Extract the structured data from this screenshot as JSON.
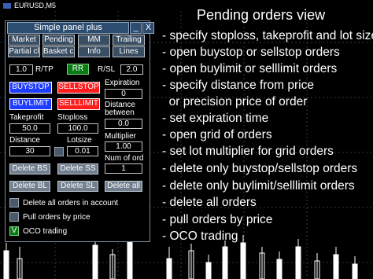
{
  "chart": {
    "symbol_title": "EURUSD,M5"
  },
  "panel": {
    "title": "Simple panel plus",
    "minimize_label": "_",
    "close_label": "X",
    "tabs_row1": [
      "Market",
      "Pending",
      "MM",
      "Trailing"
    ],
    "tabs_row2": [
      "Partial cl",
      "Basket cl",
      "Info",
      "Lines"
    ],
    "rr_ratio_value": "1.0",
    "rtp_label": "R/TP",
    "rr_button": "RR",
    "rsl_label": "R/SL",
    "rsl_value": "2.0",
    "buystop_label": "BUYSTOP",
    "sellstop_label": "SELLSTOP",
    "buylimit_label": "BUYLIMIT",
    "selllimit_label": "SELLLIMIT",
    "expiration_label": "Expiration",
    "expiration_value": "0",
    "distance_between_label_1": "Distance",
    "distance_between_label_2": "between",
    "distance_between_value": "0.0",
    "takeprofit_label": "Takeprofit",
    "takeprofit_value": "50.0",
    "stoploss_label": "Stoploss",
    "stoploss_value": "100.0",
    "multiplier_label": "Multiplier",
    "multiplier_value": "1.00",
    "distance_label": "Distance",
    "distance_value": "30",
    "lotsize_label": "Lotsize",
    "lotsize_value": "0.01",
    "num_orders_label": "Num of ord",
    "num_orders_value": "1",
    "delete_bs": "Delete BS",
    "delete_ss": "Delete SS",
    "delete_bl": "Delete BL",
    "delete_sl": "Delete SL",
    "delete_all": "Delete all",
    "opt_delete_all_label": "Delete all orders in account",
    "opt_pull_label": "Pull orders by price",
    "opt_oco_label": "OCO trading",
    "oco_check_mark": "V"
  },
  "info": {
    "title": "Pending orders view",
    "features": [
      "- specify stoploss, takeprofit and lot size",
      "- open buystop or sellstop orders",
      "- open buylimit or selllimit orders",
      "- specify distance from price",
      "  or precision price of order",
      "- set expiration time",
      "- open grid of orders",
      "- set lot multiplier for grid orders",
      "- delete only buystop/sellstop orders",
      "- delete only buylimit/selllimit orders",
      "- delete all orders",
      "- pull orders by price",
      "- OCO trading"
    ]
  },
  "colors": {
    "panel_bg": "#000000",
    "title_bar": "#2c4d70",
    "buy": "#1e3cff",
    "sell": "#ff1c1c",
    "rr": "#0a7a14",
    "button": "#707e8e"
  }
}
